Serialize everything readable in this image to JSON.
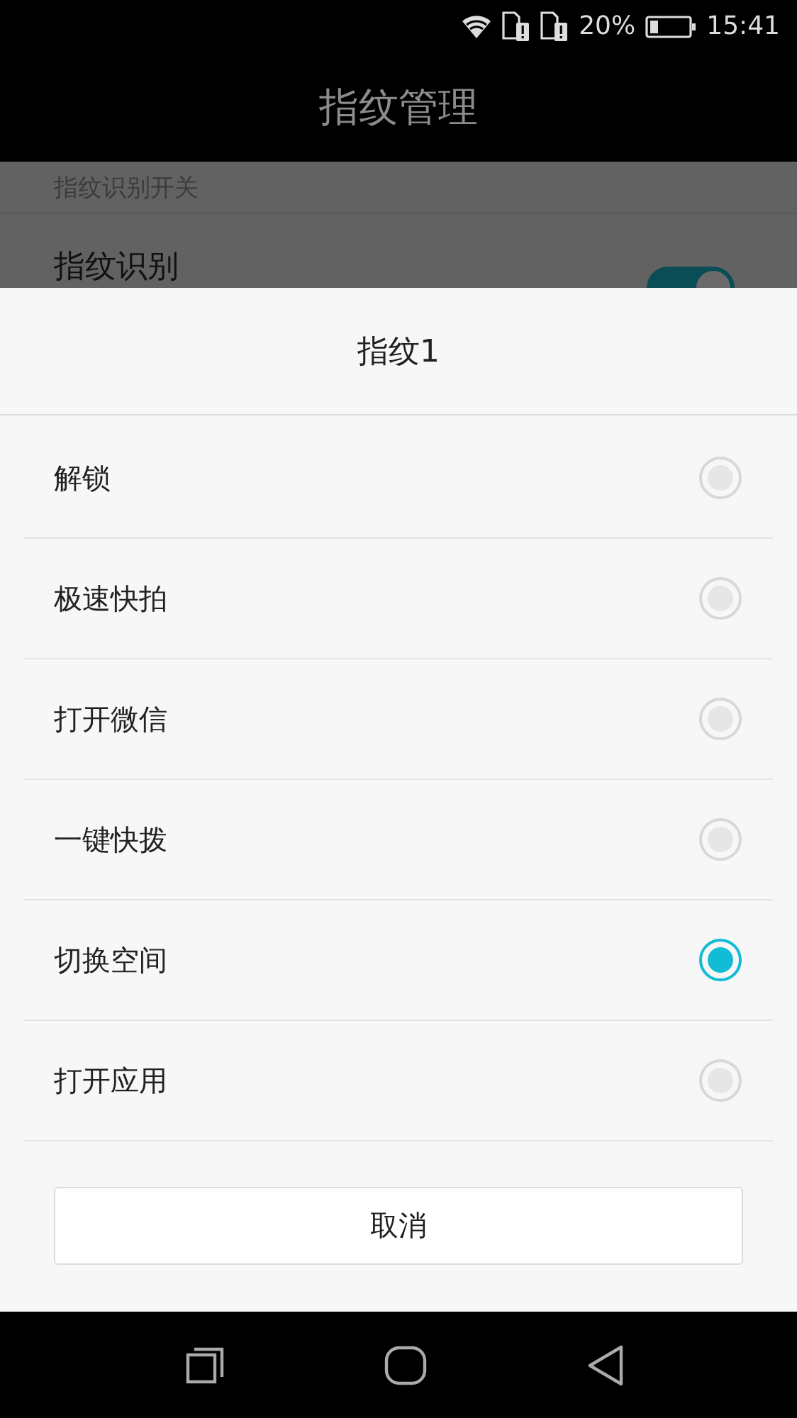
{
  "status_bar": {
    "battery_percent": "20%",
    "time": "15:41"
  },
  "app_bar": {
    "title": "指纹管理"
  },
  "background": {
    "section_header": "指纹识别开关",
    "switch": {
      "label": "指纹识别",
      "on": true
    }
  },
  "dialog": {
    "title": "指纹1",
    "options": [
      {
        "label": "解锁",
        "selected": false
      },
      {
        "label": "极速快拍",
        "selected": false
      },
      {
        "label": "打开微信",
        "selected": false
      },
      {
        "label": "一键快拨",
        "selected": false
      },
      {
        "label": "切换空间",
        "selected": true
      },
      {
        "label": "打开应用",
        "selected": false
      }
    ],
    "cancel_button": "取消"
  }
}
